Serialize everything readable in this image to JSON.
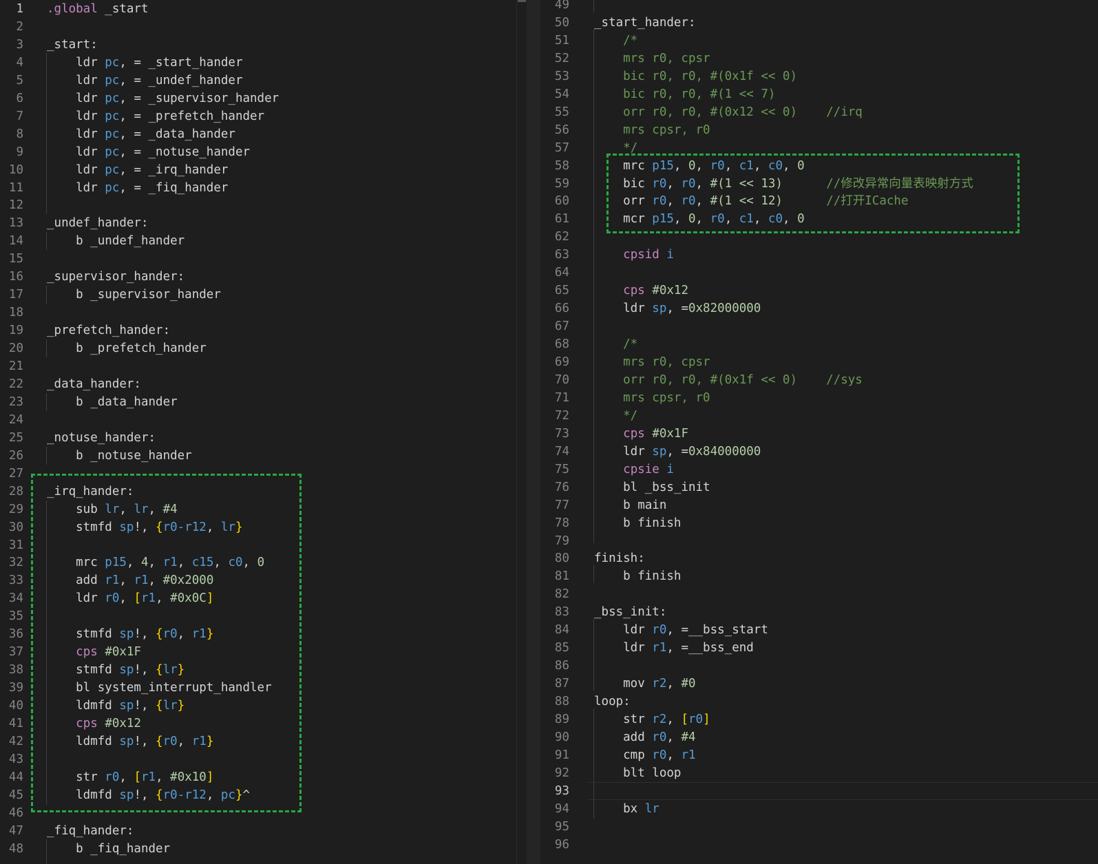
{
  "editor": {
    "colors": {
      "background": "#1e1e1e",
      "text": "#d4d4d4",
      "keyword": "#c586c0",
      "register": "#569cd6",
      "number": "#b5cea8",
      "bracket": "#ffd700",
      "comment": "#6a9955",
      "line_number": "#858585",
      "highlight_box": "#27a844"
    },
    "left_pane": {
      "first_line": 1,
      "active_line": 1,
      "lines": [
        [
          [
            "kw",
            ".global"
          ],
          [
            "txt",
            " _start"
          ]
        ],
        [],
        [
          [
            "txt",
            "_start:"
          ]
        ],
        [
          [
            "txt",
            "    ldr "
          ],
          [
            "reg",
            "pc"
          ],
          [
            "txt",
            ", = _start_hander"
          ]
        ],
        [
          [
            "txt",
            "    ldr "
          ],
          [
            "reg",
            "pc"
          ],
          [
            "txt",
            ", = _undef_hander"
          ]
        ],
        [
          [
            "txt",
            "    ldr "
          ],
          [
            "reg",
            "pc"
          ],
          [
            "txt",
            ", = _supervisor_hander"
          ]
        ],
        [
          [
            "txt",
            "    ldr "
          ],
          [
            "reg",
            "pc"
          ],
          [
            "txt",
            ", = _prefetch_hander"
          ]
        ],
        [
          [
            "txt",
            "    ldr "
          ],
          [
            "reg",
            "pc"
          ],
          [
            "txt",
            ", = _data_hander"
          ]
        ],
        [
          [
            "txt",
            "    ldr "
          ],
          [
            "reg",
            "pc"
          ],
          [
            "txt",
            ", = _notuse_hander"
          ]
        ],
        [
          [
            "txt",
            "    ldr "
          ],
          [
            "reg",
            "pc"
          ],
          [
            "txt",
            ", = _irq_hander"
          ]
        ],
        [
          [
            "txt",
            "    ldr "
          ],
          [
            "reg",
            "pc"
          ],
          [
            "txt",
            ", = _fiq_hander"
          ]
        ],
        [],
        [
          [
            "txt",
            "_undef_hander:"
          ]
        ],
        [
          [
            "txt",
            "    b _undef_hander"
          ]
        ],
        [],
        [
          [
            "txt",
            "_supervisor_hander:"
          ]
        ],
        [
          [
            "txt",
            "    b _supervisor_hander"
          ]
        ],
        [],
        [
          [
            "txt",
            "_prefetch_hander:"
          ]
        ],
        [
          [
            "txt",
            "    b _prefetch_hander"
          ]
        ],
        [],
        [
          [
            "txt",
            "_data_hander:"
          ]
        ],
        [
          [
            "txt",
            "    b _data_hander"
          ]
        ],
        [],
        [
          [
            "txt",
            "_notuse_hander:"
          ]
        ],
        [
          [
            "txt",
            "    b _notuse_hander"
          ]
        ],
        [],
        [
          [
            "txt",
            "_irq_hander:"
          ]
        ],
        [
          [
            "txt",
            "    sub "
          ],
          [
            "reg",
            "lr"
          ],
          [
            "txt",
            ", "
          ],
          [
            "reg",
            "lr"
          ],
          [
            "txt",
            ", "
          ],
          [
            "num",
            "#4"
          ]
        ],
        [
          [
            "txt",
            "    stmfd "
          ],
          [
            "reg",
            "sp"
          ],
          [
            "txt",
            "!, "
          ],
          [
            "br",
            "{"
          ],
          [
            "reg",
            "r0-r12"
          ],
          [
            "txt",
            ", "
          ],
          [
            "reg",
            "lr"
          ],
          [
            "br",
            "}"
          ]
        ],
        [],
        [
          [
            "txt",
            "    mrc "
          ],
          [
            "reg",
            "p15"
          ],
          [
            "txt",
            ", "
          ],
          [
            "num",
            "4"
          ],
          [
            "txt",
            ", "
          ],
          [
            "reg",
            "r1"
          ],
          [
            "txt",
            ", "
          ],
          [
            "reg",
            "c15"
          ],
          [
            "txt",
            ", "
          ],
          [
            "reg",
            "c0"
          ],
          [
            "txt",
            ", "
          ],
          [
            "num",
            "0"
          ]
        ],
        [
          [
            "txt",
            "    add "
          ],
          [
            "reg",
            "r1"
          ],
          [
            "txt",
            ", "
          ],
          [
            "reg",
            "r1"
          ],
          [
            "txt",
            ", "
          ],
          [
            "num",
            "#0x2000"
          ]
        ],
        [
          [
            "txt",
            "    ldr "
          ],
          [
            "reg",
            "r0"
          ],
          [
            "txt",
            ", "
          ],
          [
            "br",
            "["
          ],
          [
            "reg",
            "r1"
          ],
          [
            "txt",
            ", "
          ],
          [
            "num",
            "#0x0C"
          ],
          [
            "br",
            "]"
          ]
        ],
        [],
        [
          [
            "txt",
            "    stmfd "
          ],
          [
            "reg",
            "sp"
          ],
          [
            "txt",
            "!, "
          ],
          [
            "br",
            "{"
          ],
          [
            "reg",
            "r0"
          ],
          [
            "txt",
            ", "
          ],
          [
            "reg",
            "r1"
          ],
          [
            "br",
            "}"
          ]
        ],
        [
          [
            "txt",
            "    "
          ],
          [
            "kw",
            "cps"
          ],
          [
            "txt",
            " "
          ],
          [
            "num",
            "#0x1F"
          ]
        ],
        [
          [
            "txt",
            "    stmfd "
          ],
          [
            "reg",
            "sp"
          ],
          [
            "txt",
            "!, "
          ],
          [
            "br",
            "{"
          ],
          [
            "reg",
            "lr"
          ],
          [
            "br",
            "}"
          ]
        ],
        [
          [
            "txt",
            "    bl system_interrupt_handler"
          ]
        ],
        [
          [
            "txt",
            "    ldmfd "
          ],
          [
            "reg",
            "sp"
          ],
          [
            "txt",
            "!, "
          ],
          [
            "br",
            "{"
          ],
          [
            "reg",
            "lr"
          ],
          [
            "br",
            "}"
          ]
        ],
        [
          [
            "txt",
            "    "
          ],
          [
            "kw",
            "cps"
          ],
          [
            "txt",
            " "
          ],
          [
            "num",
            "#0x12"
          ]
        ],
        [
          [
            "txt",
            "    ldmfd "
          ],
          [
            "reg",
            "sp"
          ],
          [
            "txt",
            "!, "
          ],
          [
            "br",
            "{"
          ],
          [
            "reg",
            "r0"
          ],
          [
            "txt",
            ", "
          ],
          [
            "reg",
            "r1"
          ],
          [
            "br",
            "}"
          ]
        ],
        [],
        [
          [
            "txt",
            "    str "
          ],
          [
            "reg",
            "r0"
          ],
          [
            "txt",
            ", "
          ],
          [
            "br",
            "["
          ],
          [
            "reg",
            "r1"
          ],
          [
            "txt",
            ", "
          ],
          [
            "num",
            "#0x10"
          ],
          [
            "br",
            "]"
          ]
        ],
        [
          [
            "txt",
            "    ldmfd "
          ],
          [
            "reg",
            "sp"
          ],
          [
            "txt",
            "!, "
          ],
          [
            "br",
            "{"
          ],
          [
            "reg",
            "r0-r12"
          ],
          [
            "txt",
            ", "
          ],
          [
            "reg",
            "pc"
          ],
          [
            "br",
            "}"
          ],
          [
            "txt",
            "^"
          ]
        ],
        [],
        [
          [
            "txt",
            "_fiq_hander:"
          ]
        ],
        [
          [
            "txt",
            "    b _fiq_hander"
          ]
        ]
      ]
    },
    "right_pane": {
      "first_line": 49,
      "active_line": 93,
      "lines": [
        [],
        [
          [
            "txt",
            "_start_hander:"
          ]
        ],
        [
          [
            "cmt",
            "    /*"
          ]
        ],
        [
          [
            "cmt",
            "    mrs r0, cpsr"
          ]
        ],
        [
          [
            "cmt",
            "    bic r0, r0, #(0x1f << 0)"
          ]
        ],
        [
          [
            "cmt",
            "    bic r0, r0, #(1 << 7)"
          ]
        ],
        [
          [
            "cmt",
            "    orr r0, r0, #(0x12 << 0)    //irq"
          ]
        ],
        [
          [
            "cmt",
            "    mrs cpsr, r0"
          ]
        ],
        [
          [
            "cmt",
            "    */"
          ]
        ],
        [
          [
            "txt",
            "    mrc "
          ],
          [
            "reg",
            "p15"
          ],
          [
            "txt",
            ", "
          ],
          [
            "num",
            "0"
          ],
          [
            "txt",
            ", "
          ],
          [
            "reg",
            "r0"
          ],
          [
            "txt",
            ", "
          ],
          [
            "reg",
            "c1"
          ],
          [
            "txt",
            ", "
          ],
          [
            "reg",
            "c0"
          ],
          [
            "txt",
            ", "
          ],
          [
            "num",
            "0"
          ]
        ],
        [
          [
            "txt",
            "    bic "
          ],
          [
            "reg",
            "r0"
          ],
          [
            "txt",
            ", "
          ],
          [
            "reg",
            "r0"
          ],
          [
            "txt",
            ", "
          ],
          [
            "num",
            "#(1 << 13)"
          ],
          [
            "txt",
            "      "
          ],
          [
            "cmt",
            "//修改异常向量表映射方式"
          ]
        ],
        [
          [
            "txt",
            "    orr "
          ],
          [
            "reg",
            "r0"
          ],
          [
            "txt",
            ", "
          ],
          [
            "reg",
            "r0"
          ],
          [
            "txt",
            ", "
          ],
          [
            "num",
            "#(1 << 12)"
          ],
          [
            "txt",
            "      "
          ],
          [
            "cmt",
            "//打开ICache"
          ]
        ],
        [
          [
            "txt",
            "    mcr "
          ],
          [
            "reg",
            "p15"
          ],
          [
            "txt",
            ", "
          ],
          [
            "num",
            "0"
          ],
          [
            "txt",
            ", "
          ],
          [
            "reg",
            "r0"
          ],
          [
            "txt",
            ", "
          ],
          [
            "reg",
            "c1"
          ],
          [
            "txt",
            ", "
          ],
          [
            "reg",
            "c0"
          ],
          [
            "txt",
            ", "
          ],
          [
            "num",
            "0"
          ]
        ],
        [],
        [
          [
            "txt",
            "    "
          ],
          [
            "kw",
            "cpsid"
          ],
          [
            "txt",
            " "
          ],
          [
            "reg",
            "i"
          ]
        ],
        [],
        [
          [
            "txt",
            "    "
          ],
          [
            "kw",
            "cps"
          ],
          [
            "txt",
            " "
          ],
          [
            "num",
            "#0x12"
          ]
        ],
        [
          [
            "txt",
            "    ldr "
          ],
          [
            "reg",
            "sp"
          ],
          [
            "txt",
            ", ="
          ],
          [
            "num",
            "0x82000000"
          ]
        ],
        [],
        [
          [
            "cmt",
            "    /*"
          ]
        ],
        [
          [
            "cmt",
            "    mrs r0, cpsr"
          ]
        ],
        [
          [
            "cmt",
            "    orr r0, r0, #(0x1f << 0)    //sys"
          ]
        ],
        [
          [
            "cmt",
            "    mrs cpsr, r0"
          ]
        ],
        [
          [
            "cmt",
            "    */"
          ]
        ],
        [
          [
            "txt",
            "    "
          ],
          [
            "kw",
            "cps"
          ],
          [
            "txt",
            " "
          ],
          [
            "num",
            "#0x1F"
          ]
        ],
        [
          [
            "txt",
            "    ldr "
          ],
          [
            "reg",
            "sp"
          ],
          [
            "txt",
            ", ="
          ],
          [
            "num",
            "0x84000000"
          ]
        ],
        [
          [
            "txt",
            "    "
          ],
          [
            "kw",
            "cpsie"
          ],
          [
            "txt",
            " "
          ],
          [
            "reg",
            "i"
          ]
        ],
        [
          [
            "txt",
            "    bl _bss_init"
          ]
        ],
        [
          [
            "txt",
            "    b main"
          ]
        ],
        [
          [
            "txt",
            "    b finish"
          ]
        ],
        [],
        [
          [
            "txt",
            "finish:"
          ]
        ],
        [
          [
            "txt",
            "    b finish"
          ]
        ],
        [],
        [
          [
            "txt",
            "_bss_init:"
          ]
        ],
        [
          [
            "txt",
            "    ldr "
          ],
          [
            "reg",
            "r0"
          ],
          [
            "txt",
            ", =__bss_start"
          ]
        ],
        [
          [
            "txt",
            "    ldr "
          ],
          [
            "reg",
            "r1"
          ],
          [
            "txt",
            ", =__bss_end"
          ]
        ],
        [],
        [
          [
            "txt",
            "    mov "
          ],
          [
            "reg",
            "r2"
          ],
          [
            "txt",
            ", "
          ],
          [
            "num",
            "#0"
          ]
        ],
        [
          [
            "txt",
            "loop:"
          ]
        ],
        [
          [
            "txt",
            "    str "
          ],
          [
            "reg",
            "r2"
          ],
          [
            "txt",
            ", "
          ],
          [
            "br",
            "["
          ],
          [
            "reg",
            "r0"
          ],
          [
            "br",
            "]"
          ]
        ],
        [
          [
            "txt",
            "    add "
          ],
          [
            "reg",
            "r0"
          ],
          [
            "txt",
            ", "
          ],
          [
            "num",
            "#4"
          ]
        ],
        [
          [
            "txt",
            "    cmp "
          ],
          [
            "reg",
            "r0"
          ],
          [
            "txt",
            ", "
          ],
          [
            "reg",
            "r1"
          ]
        ],
        [
          [
            "txt",
            "    blt loop"
          ]
        ],
        [],
        [
          [
            "txt",
            "    bx "
          ],
          [
            "reg",
            "lr"
          ]
        ],
        [],
        []
      ]
    }
  }
}
